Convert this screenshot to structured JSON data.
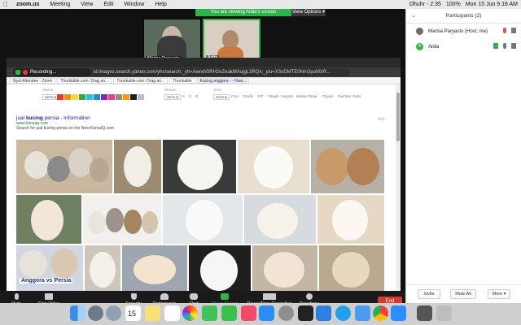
{
  "menubar": {
    "app": "zoom.us",
    "items": [
      "Meeting",
      "View",
      "Edit",
      "Window",
      "Help"
    ],
    "status": [
      "Dhuhr - 2:35",
      "100%",
      "Mon 15 Jun 9.16 AM"
    ]
  },
  "meeting": {
    "banner": "You are viewing Aidia's screen",
    "view_options": "View Options ▾",
    "participants_thumbs": [
      {
        "name": "Marisa Paryasto"
      },
      {
        "name": "Aidia"
      }
    ]
  },
  "browser": {
    "recording": "Recording...",
    "url": "id.images.search.yahoo.com/yhs/search;_ylt=AwrxhSRH2eZeakMAujgL3RQx;_ylu=X3oDMTE0Nm2poMXR...",
    "tabs": [
      "Nyal Attendee - Zoom",
      "Thunkable.com: Drag an...",
      "Thunkable.com: Drag an...",
      "Thunkable",
      "Kucing anggora - - Hasi..."
    ],
    "filters": {
      "warna": "Warna",
      "ukuran": "Ukuran",
      "jenis": "Jenis",
      "semua_color": "Semua",
      "size_options": [
        "Semua",
        "K",
        "S",
        "B"
      ],
      "type_options": [
        "Semua",
        "Foto",
        "Grafis",
        "GIF",
        "Wajah",
        "Kepala",
        "Bebas Pakai",
        "Clipart",
        "Gambar Garis"
      ],
      "swatches": [
        "#e53935",
        "#fb8c00",
        "#fdd835",
        "#43a047",
        "#26c6da",
        "#1e88e5",
        "#8e24aa",
        "#ec407a",
        "#a1887f",
        "#ff9800",
        "#212121",
        "#bdbdbd"
      ]
    },
    "result": {
      "title_pre": "jual ",
      "title_bold": "kucing",
      "title_post": " persia - Information",
      "url": "www.kensaq.com",
      "desc": "Search for jual kucing persia on the New KensaQ.com",
      "ads": "Ads"
    },
    "image_caption": "Anggora vs Persia"
  },
  "toolbar": {
    "items": [
      "Mute",
      "Stop Video",
      "Security",
      "Participants",
      "Chat",
      "Share Screen",
      "Pause/Stop Recording",
      "Reactions"
    ],
    "participants_count": "2",
    "end": "End"
  },
  "panel": {
    "title": "Participants (2)",
    "people": [
      {
        "name": "Marisa Paryasto (Host, me)",
        "color": "#7a6a5a"
      },
      {
        "name": "Aidia",
        "color": "#2fb34a",
        "initial": "A"
      }
    ],
    "invite": "Invite",
    "mute_all": "Mute All",
    "more": "More ▾"
  },
  "dock": {
    "calendar_day": "15"
  }
}
